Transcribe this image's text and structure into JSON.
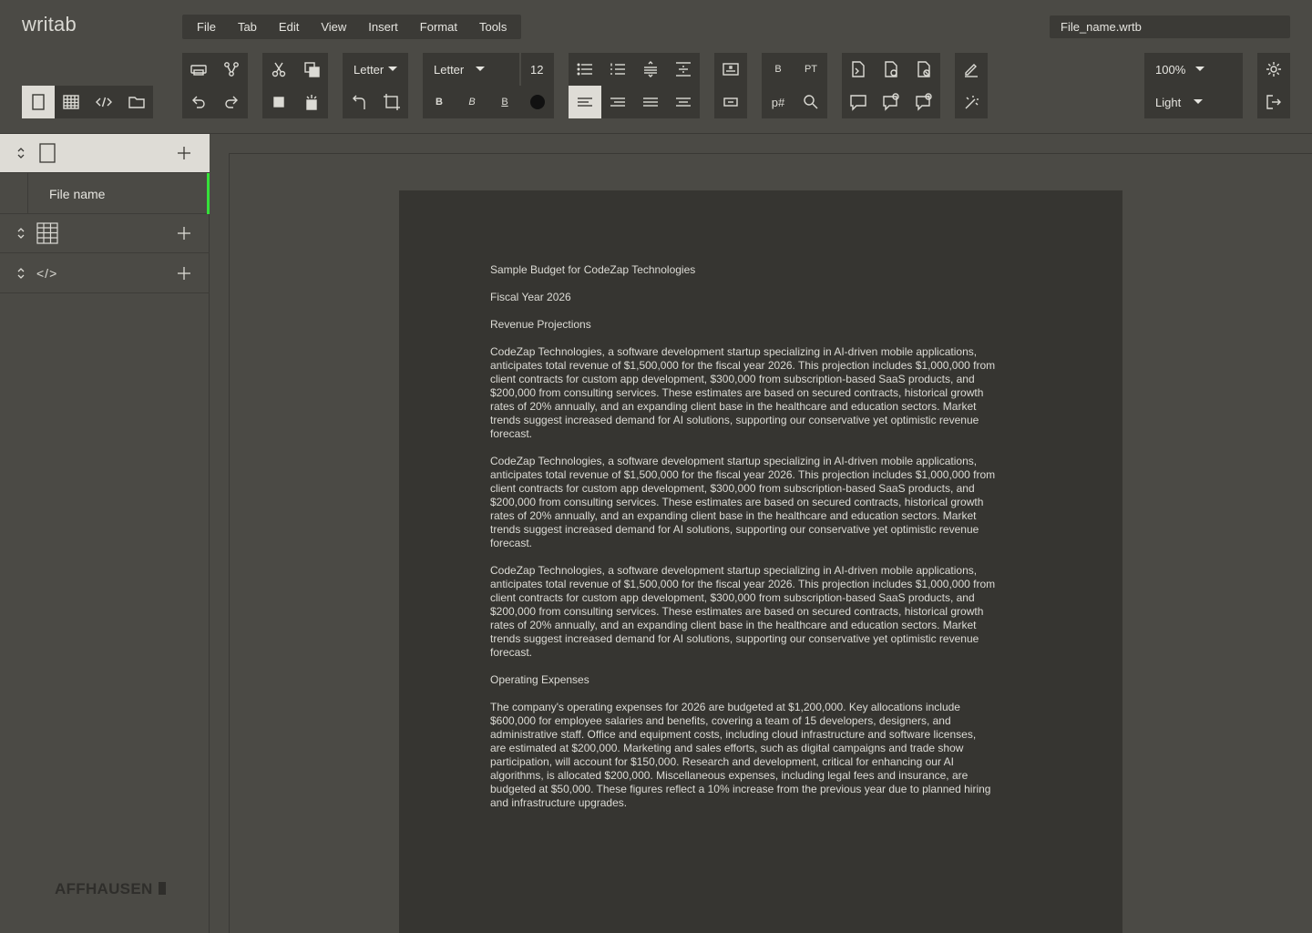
{
  "app": {
    "logo": "writab"
  },
  "menu": {
    "items": [
      "File",
      "Tab",
      "Edit",
      "View",
      "Insert",
      "Format",
      "Tools"
    ]
  },
  "file_field": {
    "value": "File_name.wrtb"
  },
  "toolbar": {
    "page_size": "Letter",
    "font": "Letter",
    "font_size": "12",
    "bold": "B",
    "italic": "B",
    "underline": "B",
    "pt_label": "PT",
    "b_sup": "B",
    "pnum": "p#",
    "zoom": "100%",
    "theme": "Light",
    "text_color": "#111111"
  },
  "view_tabs": [
    "page-icon",
    "table-icon",
    "code-icon",
    "folder-icon"
  ],
  "sidebar": {
    "sections": [
      {
        "icon": "page-icon",
        "files": [
          "File name"
        ]
      },
      {
        "icon": "table-icon",
        "files": []
      },
      {
        "icon": "code-icon",
        "label": "</>",
        "files": []
      }
    ]
  },
  "brand": "AFFHAUSEN",
  "accent": "#35e13a",
  "document": {
    "paragraphs": [
      "Sample Budget for CodeZap Technologies",
      "Fiscal Year 2026",
      "Revenue Projections",
      "CodeZap Technologies, a software development startup specializing in AI-driven mobile applications,\nanticipates total revenue of $1,500,000 for the fiscal year 2026. This projection includes $1,000,000 from\nclient contracts for custom app development, $300,000 from subscription-based SaaS products, and\n$200,000 from consulting services. These estimates are based on secured contracts, historical growth\nrates of 20% annually, and an expanding client base in the healthcare and education sectors. Market\ntrends suggest increased demand for AI solutions, supporting our conservative yet optimistic revenue\nforecast.",
      "CodeZap Technologies, a software development startup specializing in AI-driven mobile applications,\nanticipates total revenue of $1,500,000 for the fiscal year 2026. This projection includes $1,000,000 from\nclient contracts for custom app development, $300,000 from subscription-based SaaS products, and\n$200,000 from consulting services. These estimates are based on secured contracts, historical growth\nrates of 20% annually, and an expanding client base in the healthcare and education sectors. Market\ntrends suggest increased demand for AI solutions, supporting our conservative yet optimistic revenue\nforecast.",
      "CodeZap Technologies, a software development startup specializing in AI-driven mobile applications,\nanticipates total revenue of $1,500,000 for the fiscal year 2026. This projection includes $1,000,000 from\nclient contracts for custom app development, $300,000 from subscription-based SaaS products, and\n$200,000 from consulting services. These estimates are based on secured contracts, historical growth\nrates of 20% annually, and an expanding client base in the healthcare and education sectors. Market\ntrends suggest increased demand for AI solutions, supporting our conservative yet optimistic revenue\nforecast.",
      "Operating Expenses",
      "The company's operating expenses for 2026 are budgeted at $1,200,000. Key allocations include\n$600,000 for employee salaries and benefits, covering a team of 15 developers, designers, and\nadministrative staff. Office and equipment costs, including cloud infrastructure and software licenses,\nare estimated at $200,000. Marketing and sales efforts, such as digital campaigns and trade show\nparticipation, will account for $150,000. Research and development, critical for enhancing our AI\nalgorithms, is allocated $200,000. Miscellaneous expenses, including legal fees and insurance, are\nbudgeted at $50,000. These figures reflect a 10% increase from the previous year due to planned hiring\nand infrastructure upgrades."
    ]
  }
}
